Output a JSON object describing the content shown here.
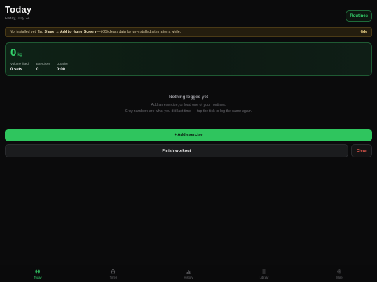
{
  "header": {
    "title": "Today",
    "date": "Friday, July 24",
    "routines_label": "Routines"
  },
  "banner": {
    "prefix": "Not installed yet. Tap",
    "share": "Share",
    "arrow": "→",
    "add_home": "Add to Home Screen",
    "suffix": "— iOS clears data for un-installed sites after a while.",
    "hide_label": "Hide"
  },
  "summary": {
    "total": "0",
    "unit": "kg",
    "stats": [
      {
        "label": "Volume lifted",
        "value": "0 sets"
      },
      {
        "label": "Exercises",
        "value": "0"
      },
      {
        "label": "Duration",
        "value": "0:00"
      }
    ]
  },
  "empty_state": {
    "title": "Nothing logged yet",
    "line1": "Add an exercise, or load one of your routines.",
    "line2": "Grey numbers are what you did last time — tap the tick to log the same again."
  },
  "actions": {
    "add_exercise": "+ Add exercise",
    "finish_workout": "Finish workout",
    "clear": "Clear"
  },
  "tabs": [
    {
      "label": "Today",
      "icon": "dumbbell-icon",
      "active": true
    },
    {
      "label": "Timer",
      "icon": "stopwatch-icon",
      "active": false
    },
    {
      "label": "History",
      "icon": "bar-chart-icon",
      "active": false
    },
    {
      "label": "Library",
      "icon": "list-icon",
      "active": false
    },
    {
      "label": "More",
      "icon": "gear-icon",
      "active": false
    }
  ],
  "colors": {
    "background": "#0b0b0c",
    "accent": "#2fc55e",
    "danger": "#e2574c",
    "banner_bg": "#241d0e"
  }
}
